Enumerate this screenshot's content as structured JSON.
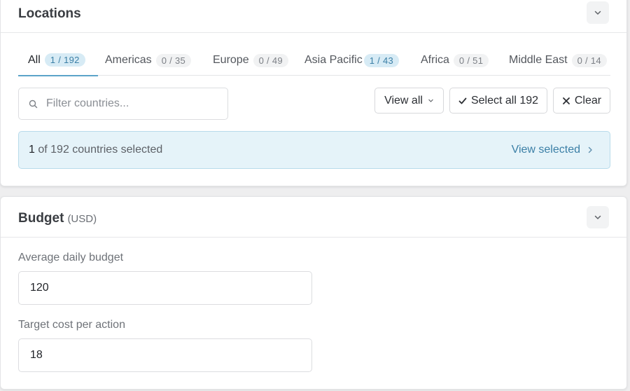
{
  "locations": {
    "title": "Locations",
    "tabs": [
      {
        "label": "All",
        "count": "1 / 192",
        "active": true
      },
      {
        "label": "Americas",
        "count": "0 / 35"
      },
      {
        "label": "Europe",
        "count": "0 / 49"
      },
      {
        "label": "Asia Pacific",
        "count": "1 / 43"
      },
      {
        "label": "Africa",
        "count": "0 / 51"
      },
      {
        "label": "Middle East",
        "count": "0 / 14"
      }
    ],
    "filter_placeholder": "Filter countries...",
    "view_all_label": "View all",
    "select_all_label": "Select all 192",
    "clear_label": "Clear",
    "summary": {
      "count": "1",
      "text": " of 192 countries selected",
      "view_selected_label": "View selected"
    }
  },
  "budget": {
    "title": "Budget",
    "unit": "(USD)",
    "daily_label": "Average daily budget",
    "daily_value": "120",
    "cpa_label": "Target cost per action",
    "cpa_value": "18"
  },
  "colors": {
    "accent": "#5ba4c9",
    "accent_text": "#3b7fa6",
    "banner_bg": "#e5f3f9"
  },
  "icons": {
    "collapse": "chevron-down-icon",
    "search": "search-icon",
    "check": "check-icon",
    "clear": "x-icon",
    "view_selected": "chevron-right-icon"
  }
}
